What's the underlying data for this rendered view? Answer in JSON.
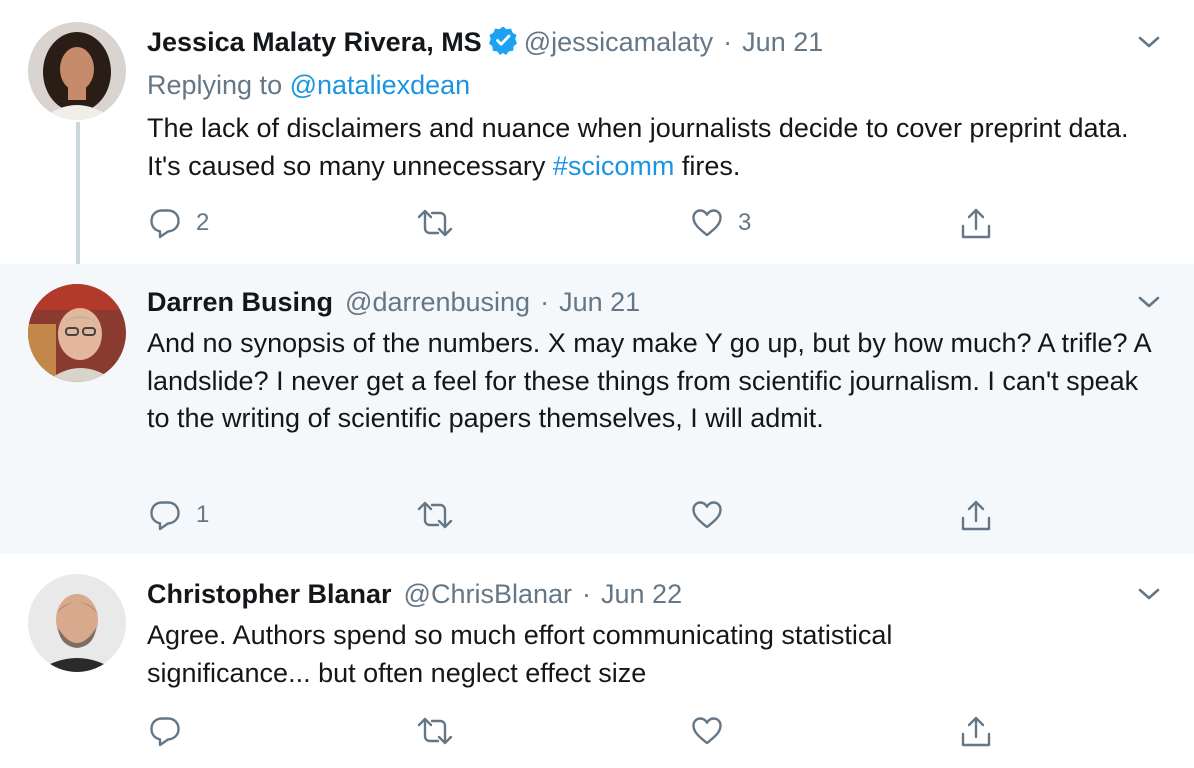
{
  "tweets": [
    {
      "name": "Jessica Malaty Rivera, MS",
      "verified": true,
      "handle": "@jessicamalaty",
      "separator": "·",
      "date": "Jun 21",
      "replying_prefix": "Replying to",
      "replying_to": "@nataliexdean",
      "text_before_tag": "The lack of disclaimers and nuance when journalists decide to cover preprint data. It's caused so many unnecessary ",
      "hashtag": "#scicomm",
      "text_after_tag": " fires.",
      "reply_count": "2",
      "retweet_count": "",
      "like_count": "3",
      "highlighted": false
    },
    {
      "name": "Darren Busing",
      "handle": "@darrenbusing",
      "separator": "·",
      "date": "Jun 21",
      "text": "And no synopsis of the numbers. X may make Y go up, but by how much? A trifle? A landslide? I never get a feel for these things from scientific journalism. I can't speak to the writing of scientific papers themselves, I will admit.",
      "reply_count": "1",
      "retweet_count": "",
      "like_count": "",
      "highlighted": true
    },
    {
      "name": "Christopher Blanar",
      "handle": "@ChrisBlanar",
      "separator": "·",
      "date": "Jun 22",
      "text": "Agree. Authors spend so much effort communicating statistical significance... but often neglect effect size",
      "reply_count": "",
      "retweet_count": "",
      "like_count": "",
      "highlighted": false
    }
  ],
  "colors": {
    "link": "#1b95e0",
    "muted": "#657786",
    "highlight_bg": "#f5f8fa",
    "thread_line": "#ccd6dd"
  },
  "icons": [
    "verified-badge-icon",
    "chevron-down-icon",
    "reply-icon",
    "retweet-icon",
    "like-icon",
    "share-icon"
  ]
}
